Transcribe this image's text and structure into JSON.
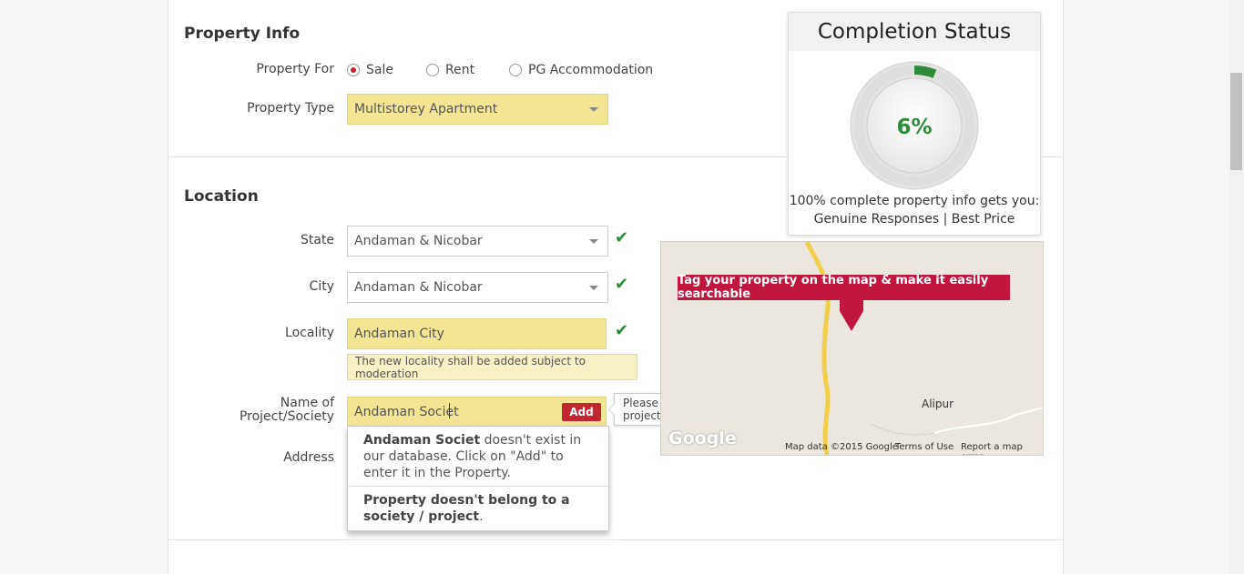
{
  "property_info": {
    "title": "Property Info",
    "property_for_label": "Property For",
    "options": [
      {
        "label": "Sale",
        "checked": true
      },
      {
        "label": "Rent",
        "checked": false
      },
      {
        "label": "PG Accommodation",
        "checked": false
      }
    ],
    "property_type_label": "Property Type",
    "property_type_value": "Multistorey Apartment"
  },
  "location": {
    "title": "Location",
    "state_label": "State",
    "state_value": "Andaman & Nicobar",
    "city_label": "City",
    "city_value": "Andaman & Nicobar",
    "locality_label": "Locality",
    "locality_value": "Andaman City",
    "locality_note": "The new locality shall be added subject to moderation",
    "project_label_line1": "Name of",
    "project_label_line2": "Project/Society",
    "project_value": "Andaman Societ",
    "add_label": "Add",
    "address_label": "Address",
    "tooltip": "Please enter the name of the project/society.",
    "dropdown": {
      "item1_bold": "Andaman Societ",
      "item1_rest": " doesn't exist in our database. Click on \"Add\" to enter it in the Property.",
      "item2_bold": "Property doesn't belong to a society / project",
      "item2_rest": "."
    }
  },
  "completion": {
    "title": "Completion Status",
    "percent_text": "6%",
    "percent_value": 6,
    "line1": "100% complete property info gets you:",
    "line2": "Genuine Responses | Best Price",
    "accent": "#2e8b3a"
  },
  "map": {
    "banner": "Tag your property on the map & make it easily searchable",
    "place_label": "Alipur",
    "logo": "Google",
    "footer_data": "Map data ©2015 Google",
    "footer_terms": "Terms of Use",
    "footer_report": "Report a map error",
    "pin_color": "#c0163f"
  },
  "icons": {
    "check": "✔"
  }
}
